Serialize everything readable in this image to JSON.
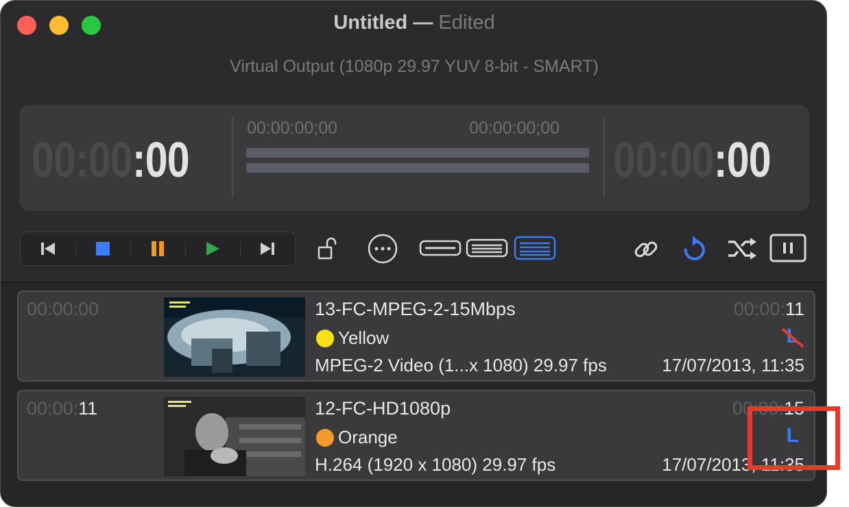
{
  "window": {
    "doc_title": "Untitled",
    "dash": "—",
    "status": "Edited",
    "output": "Virtual Output (1080p 29.97 YUV 8-bit - SMART)"
  },
  "timecode": {
    "left_dim": "00:00",
    "left_bright": ":00",
    "in_point": "00:00:00;00",
    "out_point": "00:00:00;00",
    "right_dim": "00:00",
    "right_bright": ":00"
  },
  "toolbar": {
    "transport": [
      "skip-back-icon",
      "stop-icon",
      "pause-icon",
      "play-icon",
      "skip-forward-icon"
    ],
    "icons": [
      "unlock-icon",
      "more-icon",
      "view-small-icon",
      "view-medium-icon",
      "view-large-icon",
      "link-icon",
      "repeat-icon",
      "shuffle-icon",
      "pause-box-icon"
    ],
    "colors": {
      "stop": "#3b7cf5",
      "pause": "#f39a1e",
      "play": "#2fa84f",
      "active": "#3b7cf5"
    }
  },
  "clips": [
    {
      "start_dim": "00:00:00",
      "start_bright": "",
      "name": "13-FC-MPEG-2-15Mbps",
      "color_label": "Yellow",
      "color_hex": "#f5e21b",
      "info": "MPEG-2 Video (1...x 1080) 29.97 fps",
      "duration_dim": "00:00:",
      "duration_bright": "11",
      "date": "17/07/2013, 11:35",
      "badge": "L"
    },
    {
      "start_dim": "00:00:",
      "start_bright": "11",
      "name": "12-FC-HD1080p",
      "color_label": "Orange",
      "color_hex": "#f39a2c",
      "info": "H.264 (1920 x 1080) 29.97 fps",
      "duration_dim": "00:00:",
      "duration_bright": "15",
      "date": "17/07/2013, 11:35",
      "badge": "L"
    }
  ]
}
